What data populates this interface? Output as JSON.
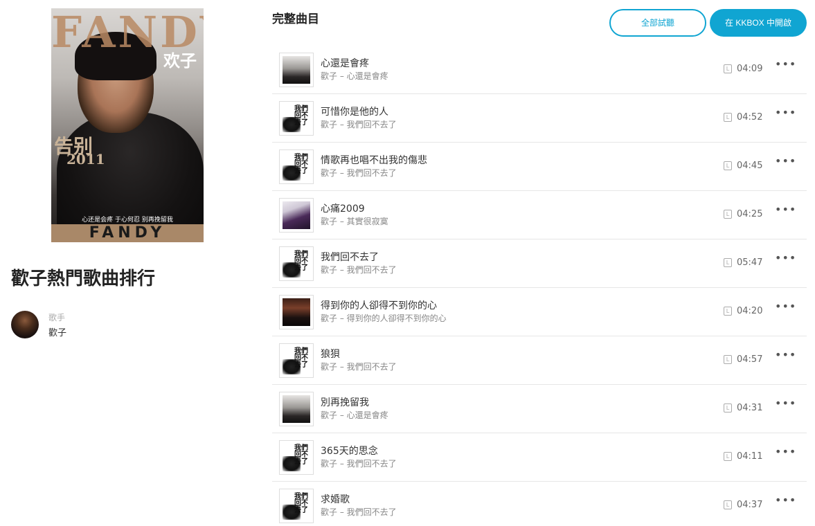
{
  "album_cover": {
    "brand": "FANDY",
    "cn_name": "欢子",
    "farewell": "告别",
    "year": "2011",
    "tagline": "心还是会疼  于心何忍  别再挽留我",
    "bottom_brand": "FANDY"
  },
  "page_title": "歡子熱門歌曲排行",
  "artist": {
    "role": "歌手",
    "name": "歡子"
  },
  "section_title": "完整曲目",
  "buttons": {
    "preview_all": "全部試聽",
    "open_in_kkbox": "在 KKBOX 中開啟"
  },
  "lyric_icon_glyph": "L",
  "more_glyph": "•••",
  "thumb_text": "我們回不去了",
  "tracks": [
    {
      "name": "心還是會疼",
      "sub": "歡子 – 心還是會疼",
      "duration": "04:09",
      "thumb": "a"
    },
    {
      "name": "可惜你是他的人",
      "sub": "歡子 – 我們回不去了",
      "duration": "04:52",
      "thumb": "b"
    },
    {
      "name": "情歌再也唱不出我的傷悲",
      "sub": "歡子 – 我們回不去了",
      "duration": "04:45",
      "thumb": "b"
    },
    {
      "name": "心痛2009",
      "sub": "歡子 – 其實很寂寞",
      "duration": "04:25",
      "thumb": "c"
    },
    {
      "name": "我們回不去了",
      "sub": "歡子 – 我們回不去了",
      "duration": "05:47",
      "thumb": "b"
    },
    {
      "name": "得到你的人卻得不到你的心",
      "sub": "歡子 – 得到你的人卻得不到你的心",
      "duration": "04:20",
      "thumb": "d"
    },
    {
      "name": "狼狽",
      "sub": "歡子 – 我們回不去了",
      "duration": "04:57",
      "thumb": "b"
    },
    {
      "name": "別再挽留我",
      "sub": "歡子 – 心還是會疼",
      "duration": "04:31",
      "thumb": "a"
    },
    {
      "name": "365天的思念",
      "sub": "歡子 – 我們回不去了",
      "duration": "04:11",
      "thumb": "b"
    },
    {
      "name": "求婚歌",
      "sub": "歡子 – 我們回不去了",
      "duration": "04:37",
      "thumb": "b"
    }
  ],
  "colors": {
    "accent": "#10a5d2"
  }
}
